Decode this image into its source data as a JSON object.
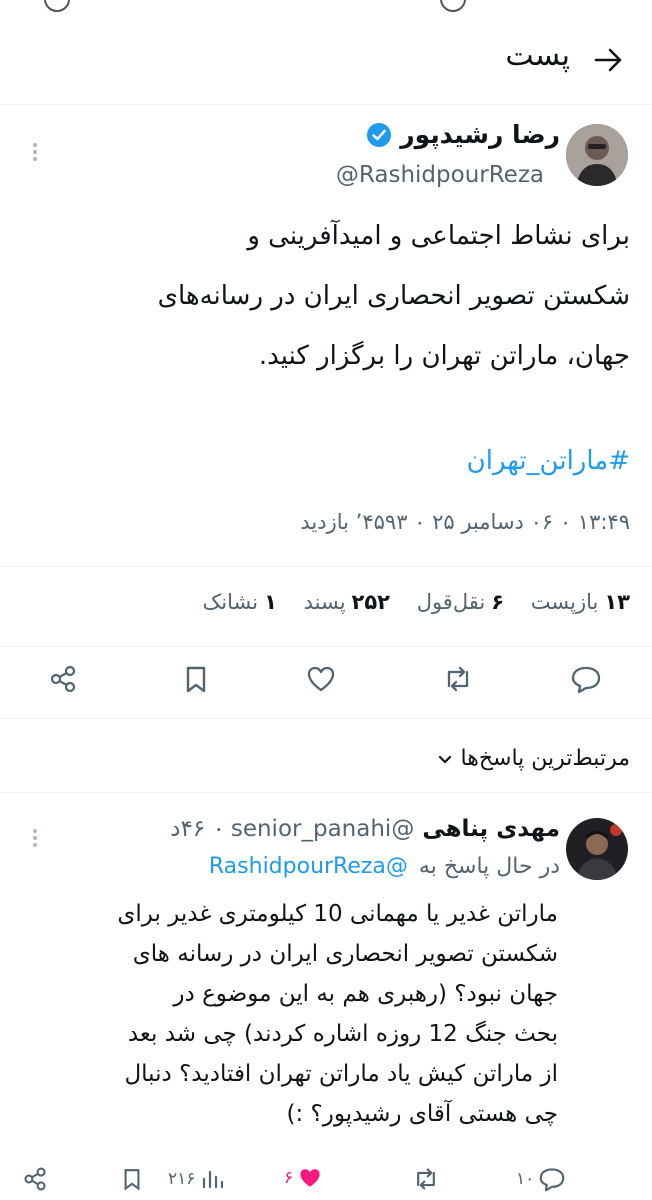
{
  "header": {
    "title": "پست"
  },
  "post": {
    "author_name": "رضا رشیدپور",
    "handle": "@RashidpourReza",
    "text_lines": [
      "برای نشاط اجتماعی و امیدآفرینی و",
      "شکستن تصویر انحصاری ایران در رسانه‌های",
      "جهان، ماراتن تهران را برگزار کنید."
    ],
    "hashtag": "#ماراتن_تهران",
    "timestamp": "۱۳:۴۹ ۰ ۰۶ دسامبر ۲۵ ۰ ۴۵۹۳’ بازدید",
    "stats": {
      "reposts_value": "۱۳",
      "reposts_label": "بازپست",
      "quotes_value": "۶",
      "quotes_label": "نقل‌قول",
      "likes_value": "۲۵۲",
      "likes_label": "پسند",
      "bookmarks_value": "۱",
      "bookmarks_label": "نشانک"
    }
  },
  "sort": {
    "label": "مرتبط‌ترین پاسخ‌ها"
  },
  "reply": {
    "author_name": "مهدی پناهی",
    "handle": "@senior_panahi",
    "time": "۰ ۴۶د",
    "replying_label": "در حال پاسخ به",
    "replying_to": "@RashidpourReza",
    "text_lines": [
      "ماراتن غدیر یا مهمانی 10 کیلومتری غدیر برای",
      "شکستن تصویر انحصاری ایران در رسانه های",
      "جهان نبود؟ (رهبری هم به این موضوع در",
      "بحث جنگ 12 روزه اشاره کردند) چی شد بعد",
      "از ماراتن کیش یاد ماراتن تهران افتادید؟ دنبال",
      "چی هستی آقای رشیدپور؟ :)"
    ],
    "comments_count": "۱۰",
    "likes_count": "۶",
    "views_count": "۲۱۶"
  },
  "colors": {
    "accent": "#1d9bf0",
    "like": "#f91880",
    "muted": "#536471"
  }
}
